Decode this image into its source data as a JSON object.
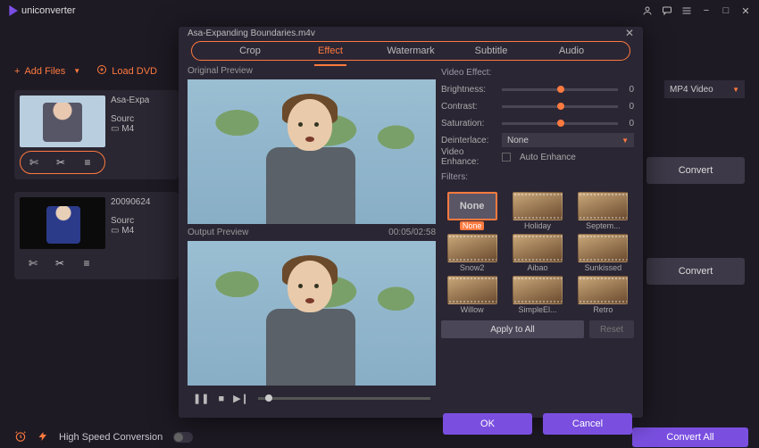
{
  "app": {
    "name": "uniconverter"
  },
  "window_icons": {
    "user": "user-icon",
    "chat": "chat-icon",
    "menu": "menu-icon",
    "min": "−",
    "max": "□",
    "close": "✕"
  },
  "toolbar": {
    "add_files": "Add Files",
    "load_dvd": "Load DVD"
  },
  "cards": [
    {
      "title": "Asa-Expa",
      "source_label": "Sourc",
      "format": "M4",
      "highlight_tools": true
    },
    {
      "title": "20090624",
      "source_label": "Sourc",
      "format": "M4",
      "highlight_tools": false
    }
  ],
  "right": {
    "output_format_value": "MP4 Video",
    "convert_label": "Convert"
  },
  "bottom": {
    "alarm_icon": "alarm",
    "high_speed_label": "High Speed Conversion",
    "convert_all": "Convert All"
  },
  "modal": {
    "title": "Asa-Expanding Boundaries.m4v",
    "tabs": [
      "Crop",
      "Effect",
      "Watermark",
      "Subtitle",
      "Audio"
    ],
    "active_tab": "Effect",
    "labels": {
      "original": "Original Preview",
      "output": "Output Preview",
      "timecode": "00:05/02:58"
    },
    "effect": {
      "header": "Video Effect:",
      "brightness_label": "Brightness:",
      "contrast_label": "Contrast:",
      "saturation_label": "Saturation:",
      "brightness": 0,
      "contrast": 0,
      "saturation": 0,
      "deinterlace_label": "Deinterlace:",
      "deinterlace_value": "None",
      "enhance_label": "Video Enhance:",
      "auto_enhance_label": "Auto Enhance"
    },
    "filters": {
      "header": "Filters:",
      "selected": "None",
      "items": [
        "None",
        "Holiday",
        "Septem...",
        "Snow2",
        "Aibao",
        "Sunkissed",
        "Willow",
        "SimpleEl...",
        "Retro"
      ]
    },
    "buttons": {
      "apply_all": "Apply to All",
      "reset": "Reset",
      "ok": "OK",
      "cancel": "Cancel"
    }
  }
}
